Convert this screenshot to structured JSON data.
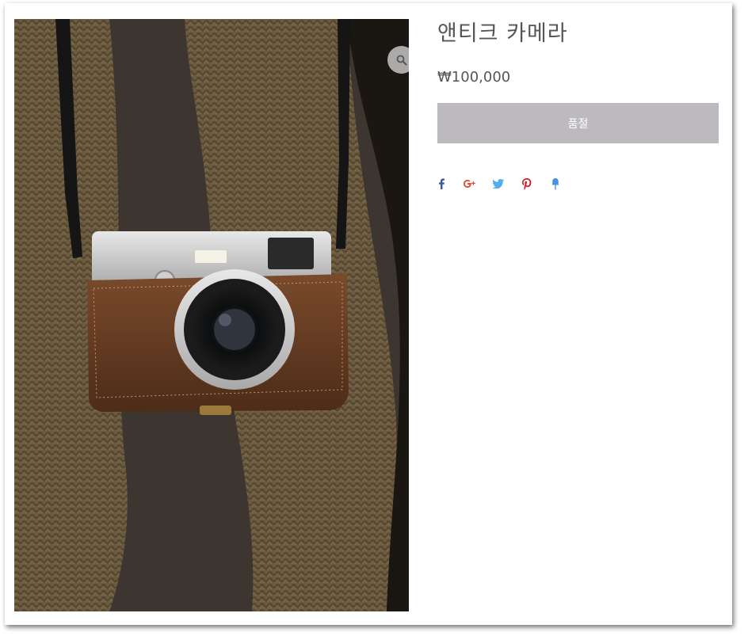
{
  "product": {
    "title": "앤티크 카메라",
    "price": "₩100,000",
    "soldout_label": "품절",
    "image_alt": "antique camera photo"
  },
  "share": [
    {
      "name": "facebook-icon",
      "color": "#3b5998"
    },
    {
      "name": "google-plus-icon",
      "color": "#dd4b39"
    },
    {
      "name": "twitter-icon",
      "color": "#55acee"
    },
    {
      "name": "pinterest-icon",
      "color": "#cb2027"
    },
    {
      "name": "pin-icon",
      "color": "#4a90e2"
    }
  ],
  "colors": {
    "soldout_bg": "#bcbabf",
    "text": "#555555"
  }
}
